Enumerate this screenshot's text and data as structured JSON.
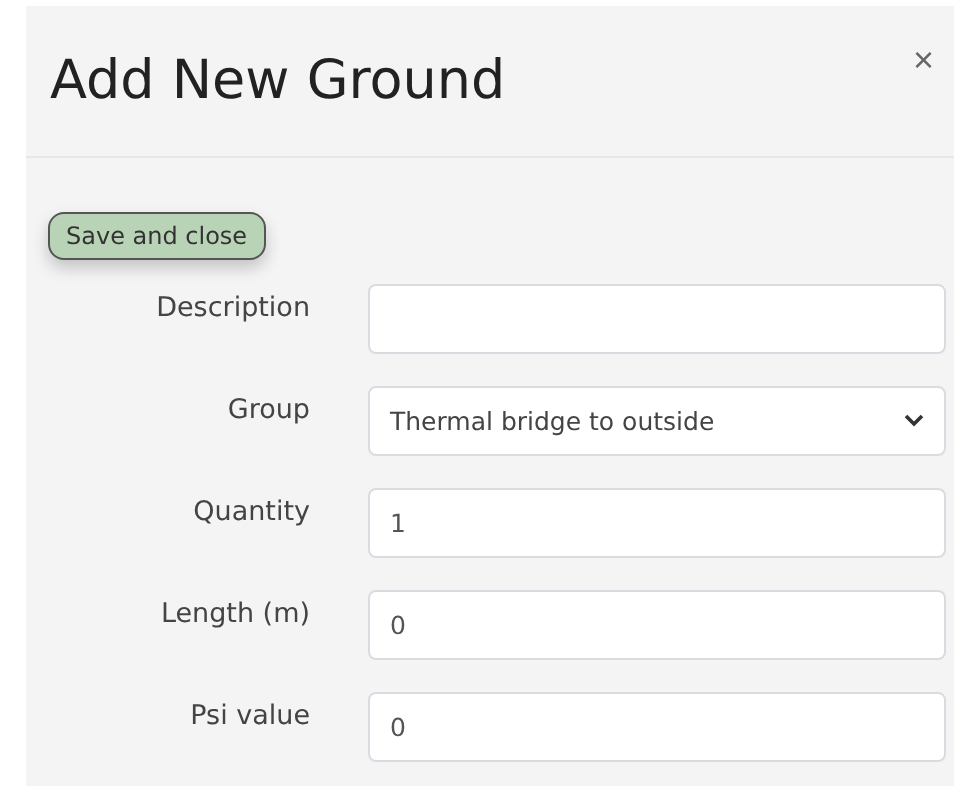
{
  "dialog": {
    "title": "Add New Ground",
    "close": "×"
  },
  "save_button": "Save and close",
  "fields": [
    {
      "label": "Description",
      "kind": "text"
    },
    {
      "label": "Group",
      "kind": "select",
      "value": "Thermal bridge to outside"
    },
    {
      "label": "Quantity",
      "kind": "text",
      "value": "1"
    },
    {
      "label": "Length (m)",
      "kind": "text",
      "value": "0"
    },
    {
      "label": "Psi value",
      "kind": "text",
      "value": "0"
    }
  ]
}
